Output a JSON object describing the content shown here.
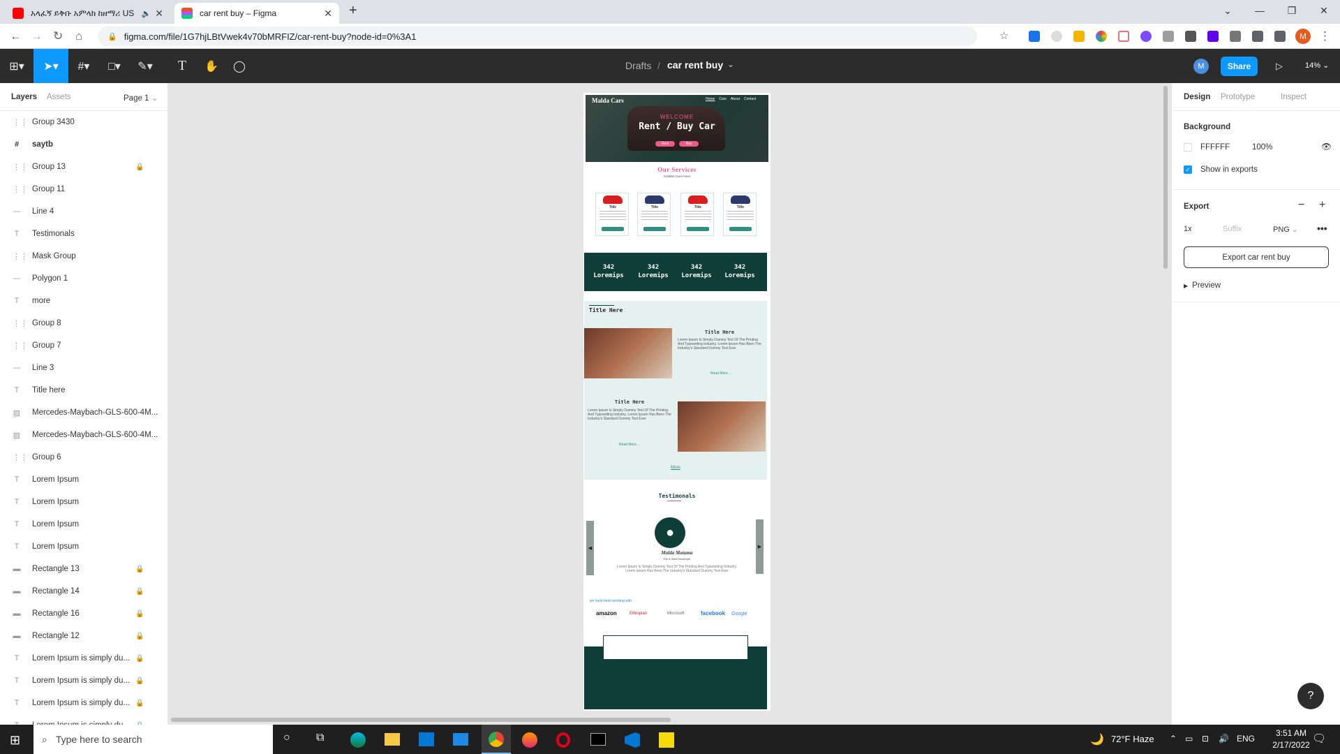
{
  "browser": {
    "tabs": [
      {
        "title": "አላፈኝ ይቅቡ አምላክ ከዘማሪ US"
      },
      {
        "title": "car rent buy – Figma"
      }
    ],
    "url": "figma.com/file/1G7hjLBtVwek4v70bMRFIZ/car-rent-buy?node-id=0%3A1"
  },
  "figma": {
    "breadcrumb_parent": "Drafts",
    "breadcrumb_sep": "/",
    "file_name": "car rent buy",
    "share_label": "Share",
    "zoom": "14%",
    "avatar_letter": "M",
    "left_tabs": {
      "layers": "Layers",
      "assets": "Assets",
      "page": "Page 1"
    },
    "layers": [
      {
        "name": "Group 3430",
        "icon": "group-icon",
        "locked": false,
        "bold": false
      },
      {
        "name": "saytb",
        "icon": "frame-icon",
        "locked": false,
        "bold": true
      },
      {
        "name": "Group 13",
        "icon": "group-icon",
        "locked": true,
        "bold": false
      },
      {
        "name": "Group 11",
        "icon": "group-icon",
        "locked": false,
        "bold": false
      },
      {
        "name": "Line 4",
        "icon": "line-icon",
        "locked": false,
        "bold": false
      },
      {
        "name": "Testimonals",
        "icon": "text-icon",
        "locked": false,
        "bold": false
      },
      {
        "name": "Mask Group",
        "icon": "group-icon",
        "locked": false,
        "bold": false
      },
      {
        "name": "Polygon 1",
        "icon": "line-icon",
        "locked": false,
        "bold": false
      },
      {
        "name": "more",
        "icon": "text-icon",
        "locked": false,
        "bold": false
      },
      {
        "name": "Group 8",
        "icon": "group-icon",
        "locked": false,
        "bold": false
      },
      {
        "name": "Group 7",
        "icon": "group-icon",
        "locked": false,
        "bold": false
      },
      {
        "name": "Line 3",
        "icon": "line-icon",
        "locked": false,
        "bold": false
      },
      {
        "name": "Title here",
        "icon": "text-icon",
        "locked": false,
        "bold": false
      },
      {
        "name": "Mercedes-Maybach-GLS-600-4M...",
        "icon": "image-icon",
        "locked": false,
        "bold": false
      },
      {
        "name": "Mercedes-Maybach-GLS-600-4M...",
        "icon": "image-icon",
        "locked": false,
        "bold": false
      },
      {
        "name": "Group 6",
        "icon": "group-icon",
        "locked": false,
        "bold": false
      },
      {
        "name": "Lorem Ipsum",
        "icon": "text-icon",
        "locked": false,
        "bold": false
      },
      {
        "name": "Lorem Ipsum",
        "icon": "text-icon",
        "locked": false,
        "bold": false
      },
      {
        "name": "Lorem Ipsum",
        "icon": "text-icon",
        "locked": false,
        "bold": false
      },
      {
        "name": "Lorem Ipsum",
        "icon": "text-icon",
        "locked": false,
        "bold": false
      },
      {
        "name": "Rectangle 13",
        "icon": "rect-icon",
        "locked": true,
        "bold": false
      },
      {
        "name": "Rectangle 14",
        "icon": "rect-icon",
        "locked": true,
        "bold": false
      },
      {
        "name": "Rectangle 16",
        "icon": "rect-icon",
        "locked": true,
        "bold": false
      },
      {
        "name": "Rectangle 12",
        "icon": "rect-icon",
        "locked": true,
        "bold": false
      },
      {
        "name": "Lorem Ipsum is simply du...",
        "icon": "text-icon",
        "locked": true,
        "bold": false
      },
      {
        "name": "Lorem Ipsum is simply du...",
        "icon": "text-icon",
        "locked": true,
        "bold": false
      },
      {
        "name": "Lorem Ipsum is simply du...",
        "icon": "text-icon",
        "locked": true,
        "bold": false
      },
      {
        "name": "Lorem Ipsum is simply du...",
        "icon": "text-icon",
        "locked": true,
        "bold": false
      }
    ],
    "right_tabs": {
      "design": "Design",
      "prototype": "Prototype",
      "inspect": "Inspect"
    },
    "background": {
      "label": "Background",
      "hex": "FFFFFF",
      "opacity": "100%"
    },
    "show_in_exports": "Show in exports",
    "export": {
      "label": "Export",
      "scale": "1x",
      "suffix_placeholder": "Suffix",
      "format": "PNG",
      "button": "Export car rent buy",
      "preview": "Preview"
    }
  },
  "design": {
    "brand": "Malda Cars",
    "nav": [
      "Home",
      "Cars",
      "About",
      "Contact"
    ],
    "welcome": "WELCOME",
    "hero_title": "Rent / Buy Car",
    "hero_btn_rent": "Rent",
    "hero_btn_buy": "Buy",
    "services_title": "Our Services",
    "services_sub": "Subtitle Goes Here",
    "card_title": "Title",
    "stat_number": "342",
    "stat_label": "Loremips",
    "section_title": "Title Here",
    "feature_title": "Title Here",
    "lorem": "Lorem Ipsum Is Simply Dummy Text Of The Printing And Typesetting Industry. Lorem Ipsum Has Been The Industry's Standard Dummy Text Ever",
    "read_more": "Read More....",
    "more": "More",
    "testimonials_title": "Testimonals",
    "person_name": "Malda Motuma",
    "person_role": "Full & Web Developer",
    "worked_with": "we have been working with",
    "logos": [
      "amazon",
      "Ethiopian",
      "Microsoft",
      "facebook",
      "Google"
    ]
  },
  "taskbar": {
    "search_placeholder": "Type here to search",
    "weather": "72°F  Haze",
    "lang": "ENG",
    "time": "3:51 AM",
    "date": "2/17/2022"
  },
  "colors": {
    "figma_blue": "#0d99ff",
    "figma_dark": "#2c2c2c",
    "design_teal": "#0f3d37",
    "design_pink": "#e85c8a"
  }
}
